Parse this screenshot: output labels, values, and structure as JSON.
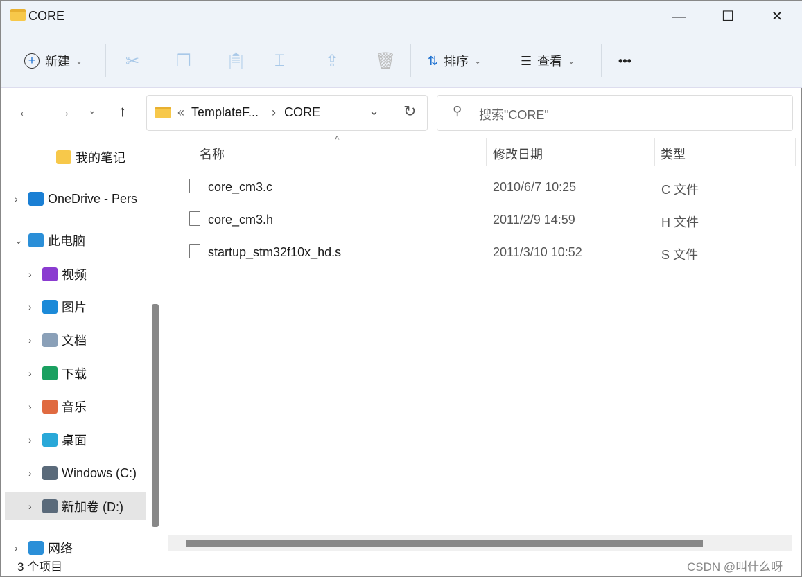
{
  "window": {
    "title": "CORE",
    "minimize": "—",
    "maximize": "☐",
    "close": "✕"
  },
  "toolbar": {
    "new_label": "新建",
    "sort_label": "排序",
    "view_label": "查看",
    "more": "•••",
    "chevron": "⌄"
  },
  "nav": {
    "back": "←",
    "forward": "→",
    "recent": "⌄",
    "up": "↑"
  },
  "address": {
    "overflow": "«",
    "path": [
      "TemplateF...",
      "CORE"
    ],
    "separator": "›",
    "dropdown": "⌄",
    "refresh": "↻"
  },
  "search": {
    "placeholder": "搜索\"CORE\""
  },
  "sidebar": {
    "items": [
      {
        "label": "我的笔记",
        "color": "#f7c84a"
      },
      {
        "label": "OneDrive - Pers",
        "color": "#1a7fd4"
      },
      {
        "label": "此电脑",
        "color": "#2b8fd8"
      },
      {
        "label": "视频",
        "color": "#8a3bd0"
      },
      {
        "label": "图片",
        "color": "#1c8ad8"
      },
      {
        "label": "文档",
        "color": "#8aa0b8"
      },
      {
        "label": "下载",
        "color": "#1aa060"
      },
      {
        "label": "音乐",
        "color": "#e06a40"
      },
      {
        "label": "桌面",
        "color": "#29a8d8"
      },
      {
        "label": "Windows  (C:)",
        "color": "#5a6a7a"
      },
      {
        "label": "新加卷 (D:)",
        "color": "#5a6a7a"
      },
      {
        "label": "网络",
        "color": "#2b8fd8"
      }
    ]
  },
  "columns": {
    "name": "名称",
    "modified": "修改日期",
    "type": "类型",
    "sort_arrow": "^"
  },
  "files": [
    {
      "name": "core_cm3.c",
      "modified": "2010/6/7 10:25",
      "type": "C 文件"
    },
    {
      "name": "core_cm3.h",
      "modified": "2011/2/9 14:59",
      "type": "H 文件"
    },
    {
      "name": "startup_stm32f10x_hd.s",
      "modified": "2011/3/10 10:52",
      "type": "S 文件"
    }
  ],
  "status": {
    "count": "3 个项目"
  },
  "watermark": "CSDN @叫什么呀"
}
